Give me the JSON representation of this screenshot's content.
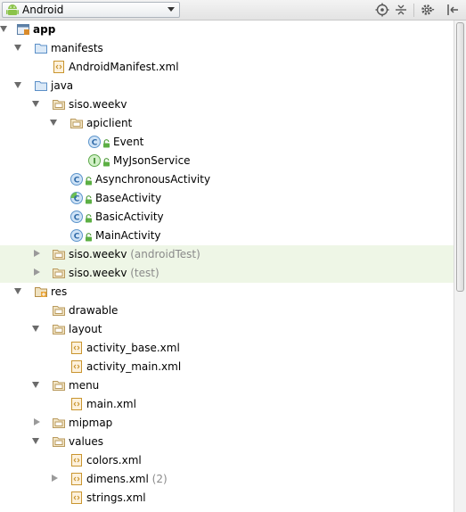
{
  "toolbar": {
    "view_label": "Android",
    "icons": [
      "target-icon",
      "collapse-all-icon",
      "gear-icon",
      "hide-panel-icon"
    ]
  },
  "tree": [
    {
      "label": "app",
      "icon": "module-icon",
      "expanded": true,
      "bold": true
    },
    {
      "label": "manifests",
      "icon": "folder-icon",
      "expanded": true
    },
    {
      "label": "AndroidManifest.xml",
      "icon": "xml-file-icon"
    },
    {
      "label": "java",
      "icon": "folder-icon",
      "expanded": true
    },
    {
      "label": "siso.weekv",
      "icon": "package-icon",
      "expanded": true
    },
    {
      "label": "apiclient",
      "icon": "package-icon",
      "expanded": true
    },
    {
      "label": "Event",
      "icon": "class-icon"
    },
    {
      "label": "MyJsonService",
      "icon": "interface-icon"
    },
    {
      "label": "AsynchronousActivity",
      "icon": "class-icon"
    },
    {
      "label": "BaseActivity",
      "icon": "abstract-class-icon"
    },
    {
      "label": "BasicActivity",
      "icon": "class-icon"
    },
    {
      "label": "MainActivity",
      "icon": "class-icon"
    },
    {
      "label": "siso.weekv",
      "suffix": "(androidTest)",
      "icon": "package-icon",
      "expanded": false
    },
    {
      "label": "siso.weekv",
      "suffix": "(test)",
      "icon": "package-icon",
      "expanded": false
    },
    {
      "label": "res",
      "icon": "res-folder-icon",
      "expanded": true
    },
    {
      "label": "drawable",
      "icon": "package-icon"
    },
    {
      "label": "layout",
      "icon": "package-icon",
      "expanded": true
    },
    {
      "label": "activity_base.xml",
      "icon": "xml-file-icon"
    },
    {
      "label": "activity_main.xml",
      "icon": "xml-file-icon"
    },
    {
      "label": "menu",
      "icon": "package-icon",
      "expanded": true
    },
    {
      "label": "main.xml",
      "icon": "xml-file-icon"
    },
    {
      "label": "mipmap",
      "icon": "package-icon",
      "expanded": false
    },
    {
      "label": "values",
      "icon": "package-icon",
      "expanded": true
    },
    {
      "label": "colors.xml",
      "icon": "xml-file-icon"
    },
    {
      "label": "dimens.xml",
      "suffix": "(2)",
      "icon": "xml-file-icon",
      "expanded": false
    },
    {
      "label": "strings.xml",
      "icon": "xml-file-icon"
    }
  ],
  "colors": {
    "highlight_row": "#eef6e6",
    "class_badge": "#6fa8dc",
    "interface_badge": "#7ccf7c",
    "folder_blue": "#5b8fc7",
    "package_tan": "#c9a86b"
  }
}
